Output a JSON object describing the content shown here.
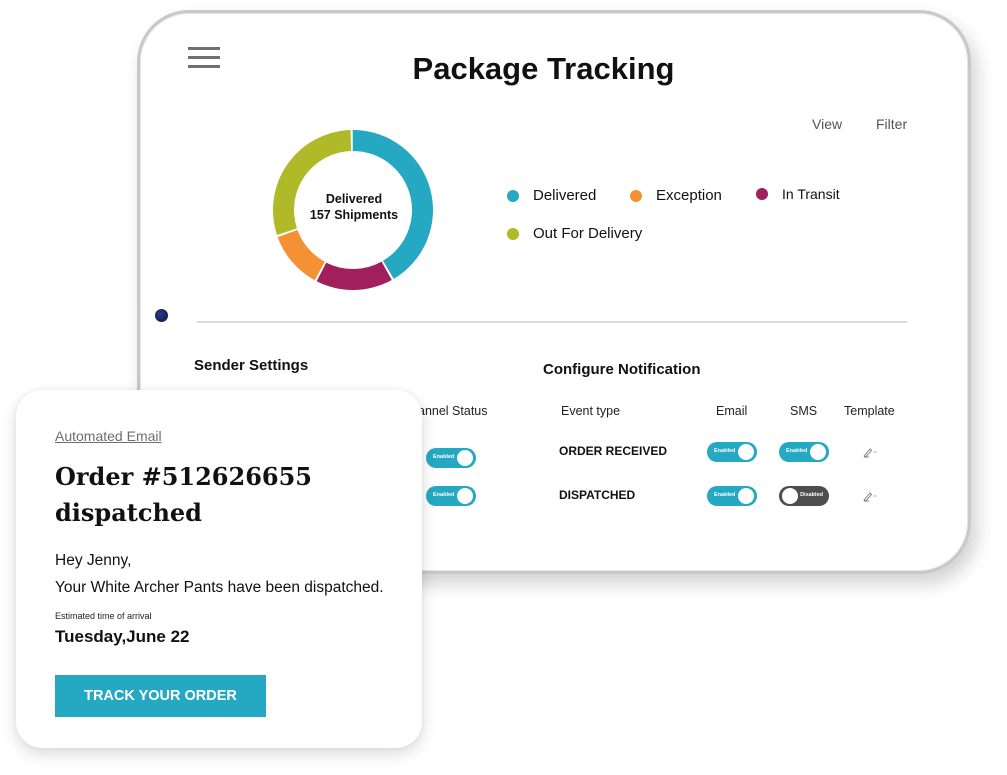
{
  "header": {
    "title": "Package Tracking",
    "menu_icon": "hamburger-menu-icon",
    "view_label": "View",
    "filter_label": "Filter"
  },
  "chart_data": {
    "type": "pie",
    "subtype": "donut",
    "center_label_line1": "Delivered",
    "center_label_line2": "157 Shipments",
    "categories": [
      "Delivered",
      "In Transit",
      "Exception",
      "Out For Delivery"
    ],
    "values": [
      42,
      16,
      12,
      30
    ],
    "unit": "percent (estimated)",
    "colors": [
      "#25a8c1",
      "#a01f5c",
      "#f39134",
      "#b0b927"
    ],
    "legend": [
      {
        "label": "Delivered",
        "color": "#25a8c1"
      },
      {
        "label": "Exception",
        "color": "#f39134"
      },
      {
        "label": "In Transit",
        "color": "#a01f5c"
      },
      {
        "label": "Out For Delivery",
        "color": "#b0b927"
      }
    ],
    "legend_position": "right"
  },
  "sender_settings": {
    "title": "Sender Settings",
    "column_header": "Channel Status",
    "column_header_visible": "annel Status",
    "toggles": [
      {
        "label": "Enabled",
        "state": "on"
      },
      {
        "label": "Enabled",
        "state": "on"
      }
    ]
  },
  "notifications": {
    "title": "Configure Notification",
    "columns": [
      "Event type",
      "Email",
      "SMS",
      "Template"
    ],
    "rows": [
      {
        "event": "ORDER RECEIVED",
        "email": {
          "label": "Enabled",
          "state": "on"
        },
        "sms": {
          "label": "Enabled",
          "state": "on"
        },
        "template_icon": "pencil-edit-icon"
      },
      {
        "event": "DISPATCHED",
        "email": {
          "label": "Enabled",
          "state": "on"
        },
        "sms": {
          "label": "Disabled",
          "state": "off"
        },
        "template_icon": "pencil-edit-icon"
      }
    ]
  },
  "email_card": {
    "tag": "Automated Email",
    "title": "Order #512626655 dispatched",
    "greeting": "Hey Jenny,",
    "body": "Your White Archer Pants have been dispatched.",
    "eta_label": "Estimated time of arrival",
    "eta_value": "Tuesday,June 22",
    "cta_label": "TRACK YOUR ORDER",
    "cta_color": "#25a8c1"
  }
}
